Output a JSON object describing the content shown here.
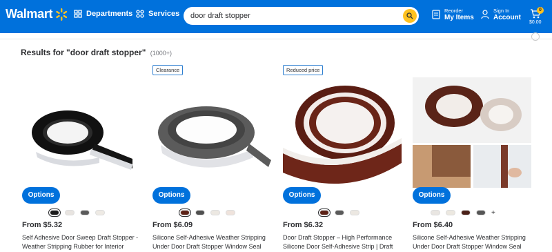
{
  "header": {
    "logo_text": "Walmart",
    "departments_label": "Departments",
    "services_label": "Services",
    "search_value": "door draft stopper",
    "reorder_small": "Reorder",
    "reorder_big": "My Items",
    "signin_small": "Sign In",
    "signin_big": "Account",
    "cart_count": "0",
    "cart_total": "$0.00",
    "colors": {
      "brand_blue": "#0071dc",
      "spark_yellow": "#ffc220"
    }
  },
  "results": {
    "label": "Results for \"door draft stopper\"",
    "count": "(1000+)"
  },
  "products": [
    {
      "badge": "",
      "options_label": "Options",
      "price": "From $5.32",
      "title": "Self Adhesive Door Sweep Draft Stopper - Weather Stripping Rubber for Interior",
      "swatches": [
        "#1b1b1b",
        "#e8e4e0",
        "#5a5a5a",
        "#eeeae4"
      ],
      "selected_swatch": 0
    },
    {
      "badge": "Clearance",
      "options_label": "Options",
      "price": "From $6.09",
      "title": "Silicone Self-Adhesive Weather Stripping Under Door Draft Stopper Window Seal",
      "swatches": [
        "#5c2216",
        "#4f4f4f",
        "#ece8e2",
        "#efe3dc"
      ],
      "selected_swatch": 0
    },
    {
      "badge": "Reduced price",
      "options_label": "Options",
      "price": "From $6.32",
      "title": "Door Draft Stopper – High Performance Silicone Door Self-Adhesive Strip | Draft",
      "swatches": [
        "#5c2216",
        "#5a5a5a",
        "#ece8e2"
      ],
      "selected_swatch": 0
    },
    {
      "badge": "",
      "options_label": "Options",
      "price": "From $6.40",
      "title": "Silicone Self-Adhesive Weather Stripping Under Door Draft Stopper Window Seal",
      "swatches": [
        "#e9e6e2",
        "#ece8e0",
        "#4a2018",
        "#555555"
      ],
      "more": "+",
      "selected_swatch": -1
    }
  ]
}
